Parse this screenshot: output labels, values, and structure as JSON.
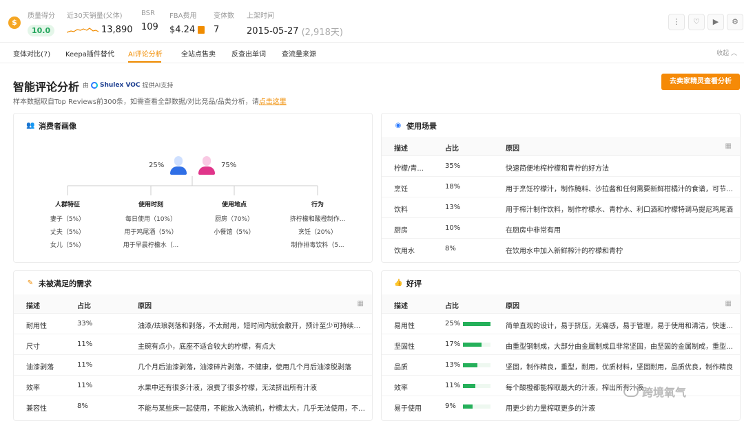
{
  "header": {
    "quality_label": "质量得分",
    "quality_value": "10.0",
    "sales_label": "近30天销量(父体)",
    "sales_value": "13,890",
    "bsr_label": "BSR",
    "bsr_value": "109",
    "fba_label": "FBA费用",
    "fba_value": "$4.24",
    "variants_label": "变体数",
    "variants_value": "7",
    "listed_label": "上架时间",
    "listed_date": "2015-05-27",
    "listed_days": "(2,918天)"
  },
  "tabs": [
    {
      "label": "变体对比(7)"
    },
    {
      "label": "Keepa插件替代"
    },
    {
      "label": "AI评论分析"
    },
    {
      "label": "全站点售卖"
    },
    {
      "label": "反查出单词"
    },
    {
      "label": "查流量来源"
    }
  ],
  "active_tab": "AI评论分析",
  "collapse_label": "收起",
  "section": {
    "title": "智能评论分析",
    "by_prefix": "由",
    "brand": "Shulex VOC",
    "by_suffix": "提供AI支持",
    "cta": "去卖家精灵查看分析",
    "desc_prefix": "样本数据取自Top Reviews前300条，如需查看全部数据/对比竞品/品类分析，请",
    "desc_link": "点击这里"
  },
  "persona": {
    "title": "消费者画像",
    "male_pct": "25%",
    "female_pct": "75%",
    "columns": [
      {
        "head": "人群特征",
        "items": [
          "妻子（5%）",
          "丈夫（5%）",
          "女儿（5%）"
        ]
      },
      {
        "head": "使用时刻",
        "items": [
          "每日使用（10%）",
          "用于鸡尾酒（5%）",
          "用于早晨柠檬水（..."
        ]
      },
      {
        "head": "使用地点",
        "items": [
          "厨房（70%）",
          "小餐馆（5%）"
        ]
      },
      {
        "head": "行为",
        "items": [
          "挤柠檬和酸橙制作...",
          "烹饪（20%）",
          "制作排毒饮料（5..."
        ]
      }
    ]
  },
  "scenes": {
    "title": "使用场景",
    "headers": [
      "描述",
      "占比",
      "原因"
    ],
    "rows": [
      {
        "desc": "柠檬/青...",
        "pct": "35%",
        "reason": "快速简便地榨柠檬和青柠的好方法"
      },
      {
        "desc": "烹饪",
        "pct": "18%",
        "reason": "用于烹饪柠檬汁，制作腌料、沙拉酱和任何需要新鲜柑橘汁的食谱，可节省..."
      },
      {
        "desc": "饮料",
        "pct": "13%",
        "reason": "用于榨汁制作饮料，制作柠檬水、青柠水、利口酒和柠檬特调马提尼鸡尾酒"
      },
      {
        "desc": "厨房",
        "pct": "10%",
        "reason": "在厨房中非常有用"
      },
      {
        "desc": "饮用水",
        "pct": "8%",
        "reason": "在饮用水中加入新鲜榨汁的柠檬和青柠"
      }
    ]
  },
  "unmet": {
    "title": "未被满足的需求",
    "headers": [
      "描述",
      "占比",
      "原因"
    ],
    "rows": [
      {
        "desc": "耐用性",
        "pct": "33%",
        "reason": "油漆/珐琅剥落和剥落，不太耐用，短时间内就会散开，预计至少可持续几个月"
      },
      {
        "desc": "尺寸",
        "pct": "11%",
        "reason": "主碗有点小，底座不适合较大的柠檬，有点大"
      },
      {
        "desc": "油漆剥落",
        "pct": "11%",
        "reason": "几个月后油漆剥落，油漆碎片剥落，不健康，使用几个月后油漆脱剥落"
      },
      {
        "desc": "效率",
        "pct": "11%",
        "reason": "水果中还有很多汁液，浪费了很多柠檬，无法挤出所有汁液"
      },
      {
        "desc": "兼容性",
        "pct": "8%",
        "reason": "不能与某些床一起使用，不能放入洗碗机，柠檬太大，几乎无法使用，不能..."
      }
    ]
  },
  "praise": {
    "title": "好评",
    "headers": [
      "描述",
      "占比",
      "原因"
    ],
    "rows": [
      {
        "desc": "易用性",
        "pct": "25%",
        "ratio": 1.0,
        "reason": "简单直观的设计，易于挤压，无痛感，易于管理，易于使用和清洁，快速便..."
      },
      {
        "desc": "坚固性",
        "pct": "17%",
        "ratio": 0.68,
        "reason": "由重型钢制成，大部分由金属制成且非常坚固，由坚固的金属制成，重型，..."
      },
      {
        "desc": "品质",
        "pct": "13%",
        "ratio": 0.52,
        "reason": "坚固，制作精良，重型，耐用，优质材料，坚固耐用，品质优良，制作精良"
      },
      {
        "desc": "效率",
        "pct": "11%",
        "ratio": 0.44,
        "reason": "每个酸橙都能榨取最大的汁液，榨出所有汁液"
      },
      {
        "desc": "易于使用",
        "pct": "9%",
        "ratio": 0.36,
        "reason": "用更少的力量榨取更多的汁液"
      }
    ],
    "bar_color": "#25b05a"
  },
  "watermark": "跨境氧气"
}
